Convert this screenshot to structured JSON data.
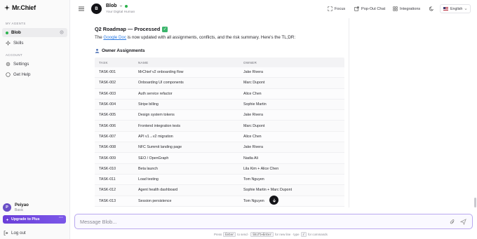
{
  "app": {
    "logo_text": "Mr.Chief"
  },
  "sidebar": {
    "my_agents_label": "MY AGENTS",
    "account_label": "ACCOUNT",
    "agents": [
      {
        "label": "Blob",
        "active": true
      },
      {
        "label": "Skills",
        "active": false
      }
    ],
    "account_items": [
      {
        "label": "Settings",
        "icon": "gear-icon"
      },
      {
        "label": "Get Help",
        "icon": "help-circle-icon"
      }
    ],
    "user": {
      "initial": "P",
      "name": "Peiyao",
      "plan": "Basic"
    },
    "upgrade_label": "Upgrade to Plus",
    "upgrade_more": "···",
    "logout_label": "Log out"
  },
  "header": {
    "bot_initial": "B",
    "bot_name": "Blob",
    "bot_subtitle": "Your Digital Human",
    "buttons": [
      {
        "label": "Focus",
        "icon": "focus-icon"
      },
      {
        "label": "Pop-Out Chat",
        "icon": "popout-icon"
      },
      {
        "label": "Integrations",
        "icon": "grid-icon"
      }
    ],
    "language": "English"
  },
  "message": {
    "title": "Q2 Roadmap — Processed",
    "check": "✓",
    "text_before": "The ",
    "link_text": "Google Doc",
    "text_after": " is now updated with all assignments, conflicts, and the risk summary. Here's the TL;DR:",
    "section_title": "Owner Assignments"
  },
  "table": {
    "headers": [
      "TASK",
      "NAME",
      "OWNER"
    ],
    "rows": [
      [
        "TASK-001",
        "MrChief v2 onboarding flow",
        "Jake Rivera"
      ],
      [
        "TASK-002",
        "Onboarding UI components",
        "Marc Dupont"
      ],
      [
        "TASK-003",
        "Auth service refactor",
        "Alice Chen"
      ],
      [
        "TASK-004",
        "Stripe billing",
        "Sophie Martin"
      ],
      [
        "TASK-005",
        "Design system tokens",
        "Jake Rivera"
      ],
      [
        "TASK-006",
        "Frontend integration tests",
        "Marc Dupont"
      ],
      [
        "TASK-007",
        "API v1→v2 migration",
        "Alice Chen"
      ],
      [
        "TASK-008",
        "NFC Summit landing page",
        "Jake Rivera"
      ],
      [
        "TASK-009",
        "SEO / OpenGraph",
        "Nadia Ali"
      ],
      [
        "TASK-010",
        "Beta launch",
        "Lila Kim + Alice Chen"
      ],
      [
        "TASK-011",
        "Load testing",
        "Tom Nguyen"
      ],
      [
        "TASK-012",
        "Agent health dashboard",
        "Sophie Martin + Marc Dupont"
      ],
      [
        "TASK-013",
        "Session persistence",
        "Tom Nguyen"
      ]
    ]
  },
  "composer": {
    "placeholder": "Message Blob...",
    "hint_press": "Press",
    "hint_enter": "Enter",
    "hint_to_send": "to send ·",
    "hint_shift_enter": "Shift+Enter",
    "hint_newline": "for new line · type",
    "hint_slash": "/",
    "hint_commands": "for commands"
  },
  "colors": {
    "accent": "#6b3fd9",
    "online": "#2bb24c",
    "link": "#2a7ae2"
  }
}
